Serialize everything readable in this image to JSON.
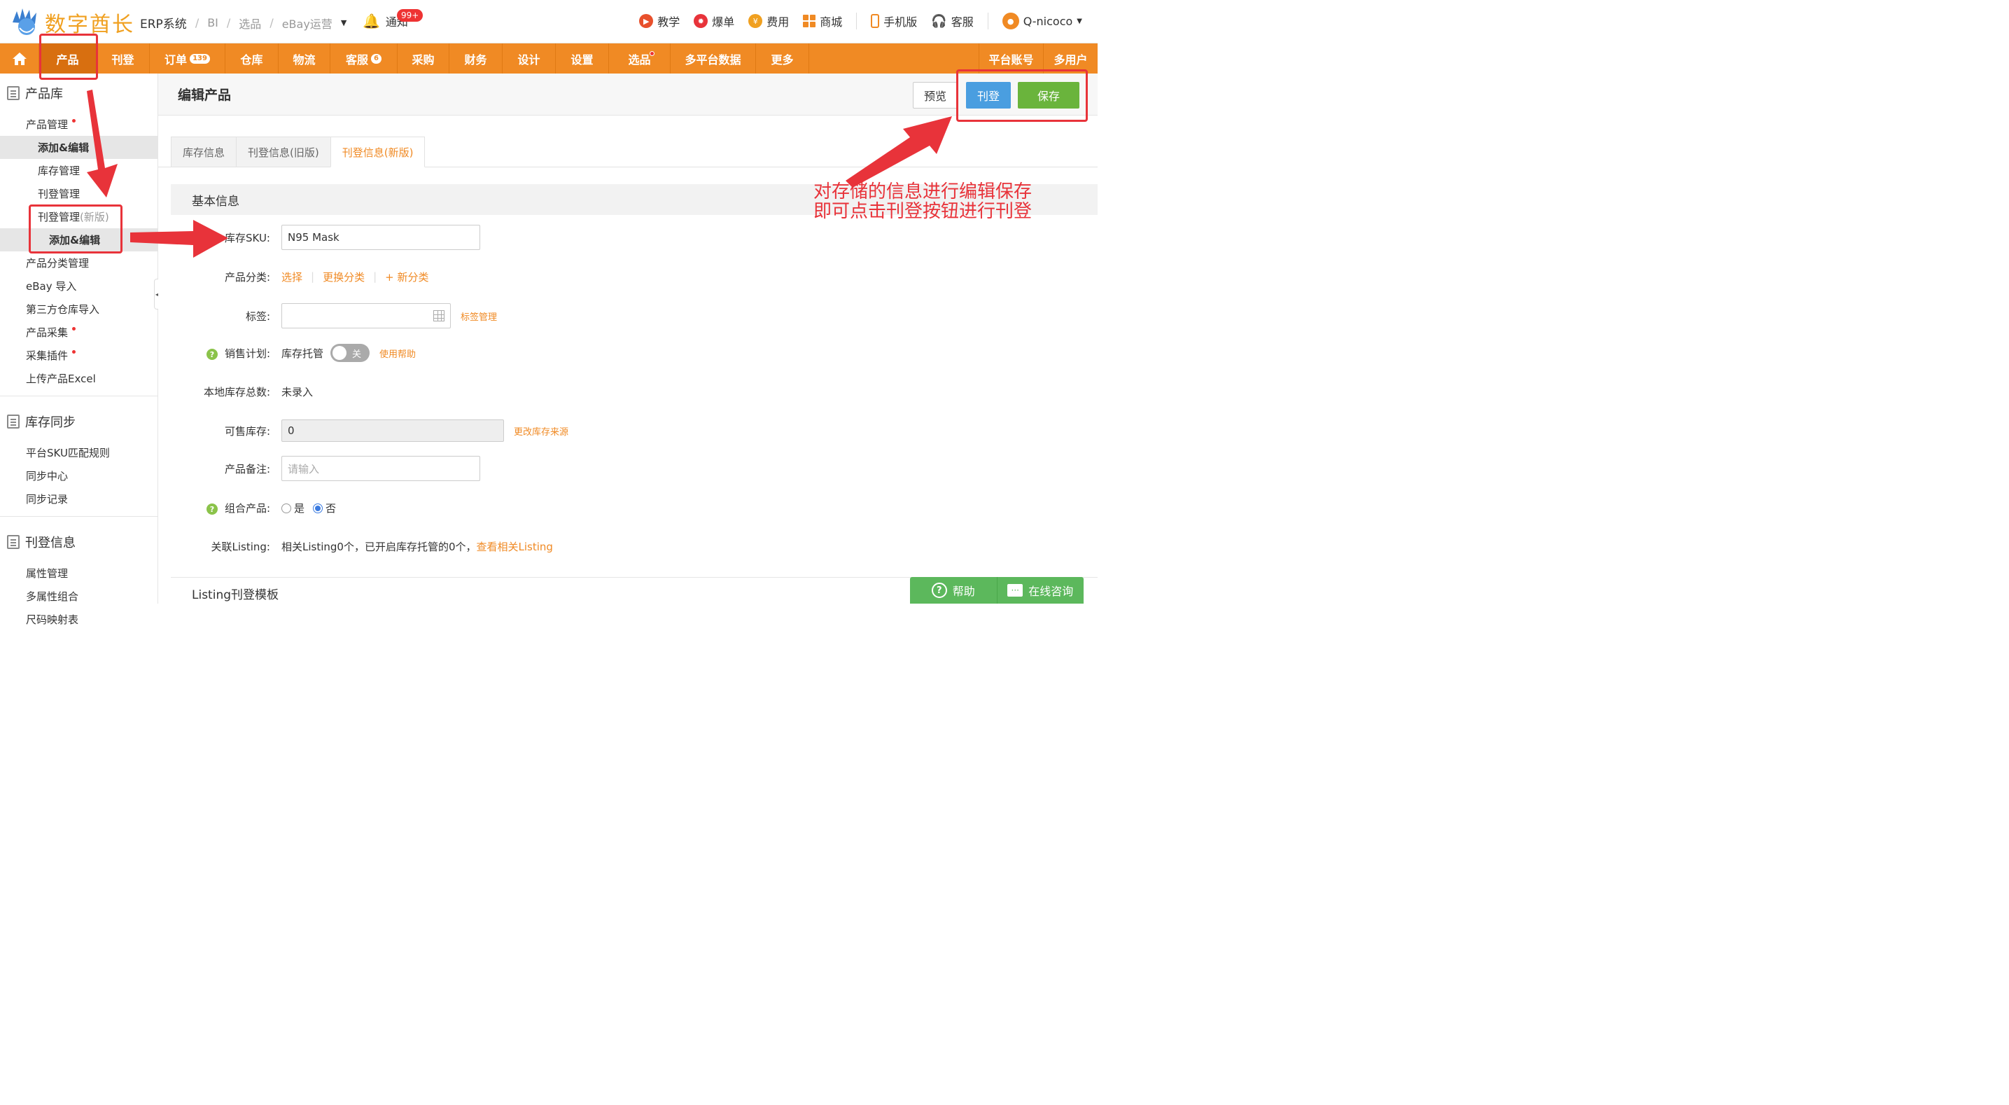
{
  "header": {
    "logo_text": "数字酋长",
    "breadcrumb": [
      "ERP系统",
      "BI",
      "选品",
      "eBay运营"
    ],
    "notify_label": "通知",
    "notify_badge": "99+",
    "right_items": [
      "教学",
      "爆单",
      "费用",
      "商城",
      "手机版",
      "客服",
      "Q-nicoco"
    ]
  },
  "nav": {
    "items": [
      {
        "label": "产品",
        "active": true
      },
      {
        "label": "刊登"
      },
      {
        "label": "订单",
        "badge": "139"
      },
      {
        "label": "仓库"
      },
      {
        "label": "物流"
      },
      {
        "label": "客服",
        "badge": "6"
      },
      {
        "label": "采购"
      },
      {
        "label": "财务"
      },
      {
        "label": "设计"
      },
      {
        "label": "设置"
      },
      {
        "label": "选品",
        "dot": true
      },
      {
        "label": "多平台数据"
      },
      {
        "label": "更多"
      }
    ],
    "right": [
      "平台账号",
      "多用户"
    ]
  },
  "sidebar": {
    "sections": [
      {
        "title": "产品库",
        "items": [
          "产品管理",
          "添加&编辑",
          "库存管理",
          "刊登管理",
          "刊登管理",
          "(新版)",
          "添加&编辑",
          "产品分类管理",
          "eBay 导入",
          "第三方仓库导入",
          "产品采集",
          "采集插件",
          "上传产品Excel"
        ]
      },
      {
        "title": "库存同步",
        "items": [
          "平台SKU匹配规则",
          "同步中心",
          "同步记录"
        ]
      },
      {
        "title": "刊登信息",
        "items": [
          "属性管理",
          "多属性组合",
          "尺码映射表"
        ]
      }
    ]
  },
  "main": {
    "page_title": "编辑产品",
    "buttons": {
      "preview": "预览",
      "list": "刊登",
      "save": "保存"
    },
    "tabs": [
      "库存信息",
      "刊登信息(旧版)",
      "刊登信息(新版)"
    ],
    "section_basic": "基本信息",
    "section_template": "Listing刊登模板",
    "fields": {
      "sku_label": "库存SKU:",
      "sku_value": "N95 Mask",
      "category_label": "产品分类:",
      "category_links": [
        "选择",
        "更换分类",
        "+ 新分类"
      ],
      "tag_label": "标签:",
      "tag_link": "标签管理",
      "plan_label": "销售计划:",
      "plan_text": "库存托管",
      "plan_toggle": "关",
      "plan_help": "使用帮助",
      "local_stock_label": "本地库存总数:",
      "local_stock_value": "未录入",
      "sellable_label": "可售库存:",
      "sellable_value": "0",
      "sellable_link": "更改库存来源",
      "remark_label": "产品备注:",
      "remark_placeholder": "请输入",
      "combo_label": "组合产品:",
      "combo_yes": "是",
      "combo_no": "否",
      "listing_label": "关联Listing:",
      "listing_text": "相关Listing0个，已开启库存托管的0个，",
      "listing_link": "查看相关Listing"
    }
  },
  "help_bar": {
    "help": "帮助",
    "consult": "在线咨询"
  },
  "annotation": {
    "line1": "对存储的信息进行编辑保存",
    "line2": "即可点击刊登按钮进行刊登"
  },
  "colors": {
    "accent": "#f08a24",
    "annotation": "#e8333a",
    "save": "#6ab43c",
    "list": "#4a9ee0"
  }
}
